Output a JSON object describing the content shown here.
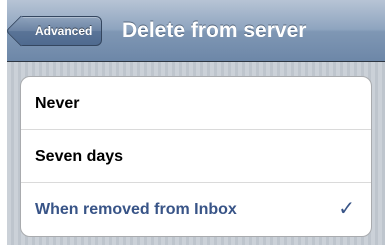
{
  "navbar": {
    "back_label": "Advanced",
    "title": "Delete from server"
  },
  "options": [
    {
      "label": "Never",
      "selected": false
    },
    {
      "label": "Seven days",
      "selected": false
    },
    {
      "label": "When removed from Inbox",
      "selected": true
    }
  ],
  "checkmark_glyph": "✓",
  "colors": {
    "navbar": "#7f97b4",
    "selected_text": "#385487",
    "background": "#c5ccd4"
  }
}
